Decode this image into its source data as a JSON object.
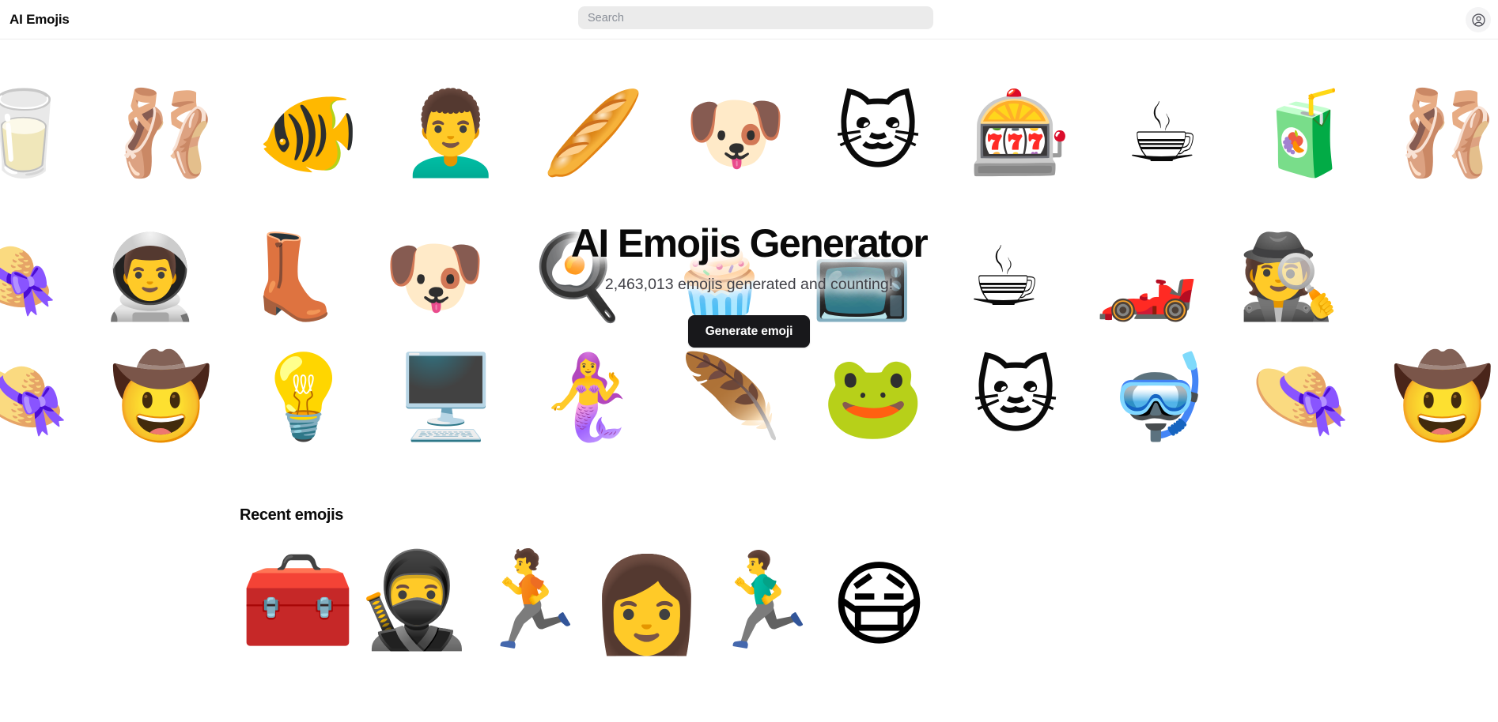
{
  "header": {
    "brand": "AI Emojis",
    "search": {
      "placeholder": "Search",
      "value": ""
    },
    "account_icon": "user-circle-icon"
  },
  "hero": {
    "title": "AI Emojis Generator",
    "subtitle": "2,463,013 emojis generated and counting!",
    "generated_count": "2,463,013",
    "cta_label": "Generate emoji",
    "background_rows": [
      {
        "row": 1,
        "emojis": [
          {
            "name": "milkshake-drink",
            "glyph": "🥛"
          },
          {
            "name": "ballet-dancer",
            "glyph": "🩰"
          },
          {
            "name": "betta-fish",
            "glyph": "🐠"
          },
          {
            "name": "curly-hair-man",
            "glyph": "👨‍🦱"
          },
          {
            "name": "bread-basket",
            "glyph": "🥖"
          },
          {
            "name": "bulldog-face",
            "glyph": "🐶"
          },
          {
            "name": "cat-with-hat",
            "glyph": "🐱"
          },
          {
            "name": "claw-machine",
            "glyph": "🎰"
          },
          {
            "name": "coffee-cup",
            "glyph": "☕"
          },
          {
            "name": "apple-juice-glass",
            "glyph": "🧃"
          },
          {
            "name": "ballet-dancer-2",
            "glyph": "🩰"
          }
        ]
      },
      {
        "row": 2,
        "emojis": [
          {
            "name": "white-hat",
            "glyph": "👒"
          },
          {
            "name": "astronaut",
            "glyph": "👨‍🚀"
          },
          {
            "name": "combat-boot",
            "glyph": "👢"
          },
          {
            "name": "dog-with-headphones",
            "glyph": "🐶"
          },
          {
            "name": "egg-on-toast",
            "glyph": "🍳"
          },
          {
            "name": "pink-frosting",
            "glyph": "🧁"
          },
          {
            "name": "arcade-box",
            "glyph": "📺"
          },
          {
            "name": "espresso-machine",
            "glyph": "☕"
          },
          {
            "name": "formula-one-car",
            "glyph": "🏎️"
          },
          {
            "name": "man-with-fedora",
            "glyph": "🕵️"
          }
        ]
      },
      {
        "row": 3,
        "emojis": [
          {
            "name": "pale-blue-hat",
            "glyph": "👒"
          },
          {
            "name": "face-with-fedora",
            "glyph": "🤠"
          },
          {
            "name": "light-bulb",
            "glyph": "💡"
          },
          {
            "name": "retro-computer",
            "glyph": "🖥️"
          },
          {
            "name": "mermaid",
            "glyph": "🧜‍♀️"
          },
          {
            "name": "peacock-feather",
            "glyph": "🪶"
          },
          {
            "name": "soldier-frog",
            "glyph": "🐸"
          },
          {
            "name": "tabby-cat-face",
            "glyph": "🐱"
          },
          {
            "name": "scuba-diver",
            "glyph": "🤿"
          },
          {
            "name": "blue-fedora",
            "glyph": "👒"
          },
          {
            "name": "face-with-fedora-2",
            "glyph": "🤠"
          }
        ]
      }
    ]
  },
  "recent": {
    "title": "Recent emojis",
    "items": [
      {
        "name": "control-panel-case",
        "glyph": "🧰"
      },
      {
        "name": "masked-person-with-gun",
        "glyph": "🥷"
      },
      {
        "name": "people-running",
        "glyph": "🏃"
      },
      {
        "name": "portrait-face",
        "glyph": "👩"
      },
      {
        "name": "crowd-running",
        "glyph": "🏃‍♂️"
      },
      {
        "name": "person-in-towel-with-mask",
        "glyph": "😷"
      }
    ]
  },
  "colors": {
    "accent": "#18181b",
    "page_background": "#ffffff",
    "search_background": "#ebebeb",
    "muted_text": "#3f3f46",
    "border": "#ececec"
  }
}
